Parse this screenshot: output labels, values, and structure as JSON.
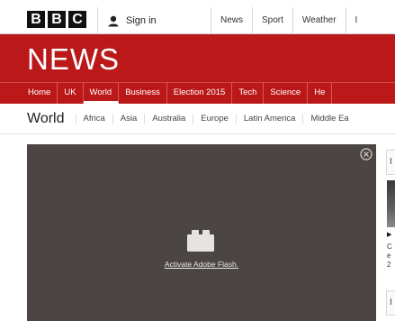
{
  "header": {
    "logo_letters": [
      "B",
      "B",
      "C"
    ],
    "signin_label": "Sign in",
    "nav_items": [
      "News",
      "Sport",
      "Weather",
      "I"
    ]
  },
  "masthead": {
    "title": "NEWS"
  },
  "rednav": {
    "items": [
      "Home",
      "UK",
      "World",
      "Business",
      "Election 2015",
      "Tech",
      "Science",
      "He"
    ],
    "active": "World"
  },
  "subnav": {
    "section_title": "World",
    "items": [
      "Africa",
      "Asia",
      "Australia",
      "Europe",
      "Latin America",
      "Middle Ea"
    ]
  },
  "video": {
    "flash_label": "Activate Adobe Flash."
  },
  "sidebar": {
    "tab_letter": "I",
    "play_glyph": "▶",
    "text_lines": [
      "C",
      "e",
      "2"
    ],
    "tab2_letter": "I"
  },
  "colors": {
    "brand_red": "#bb1919",
    "video_bg": "#4b4643"
  }
}
